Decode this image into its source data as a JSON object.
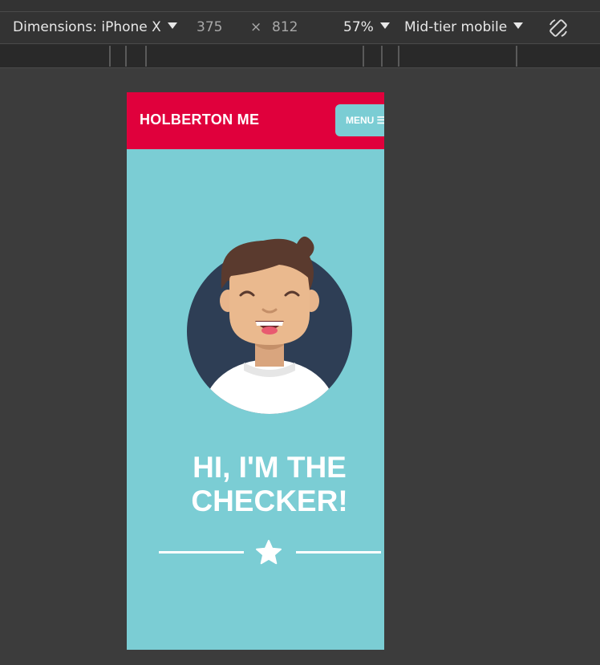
{
  "devtools": {
    "dimensions_label": "Dimensions: iPhone X",
    "width_value": "375",
    "times_sign": "×",
    "height_value": "812",
    "zoom": "57%",
    "throttling": "Mid-tier mobile",
    "rotate_icon": "rotate-icon"
  },
  "site": {
    "brand": "HOLBERTON ME",
    "menu_label": "MENU ☰",
    "hero_title_line1": "HI, I'M THE",
    "hero_title_line2": "CHECKER!",
    "star_icon": "star-icon"
  },
  "colors": {
    "header": "#e0003c",
    "accent": "#7bcdd4",
    "avatar_bg": "#2e3e55"
  }
}
